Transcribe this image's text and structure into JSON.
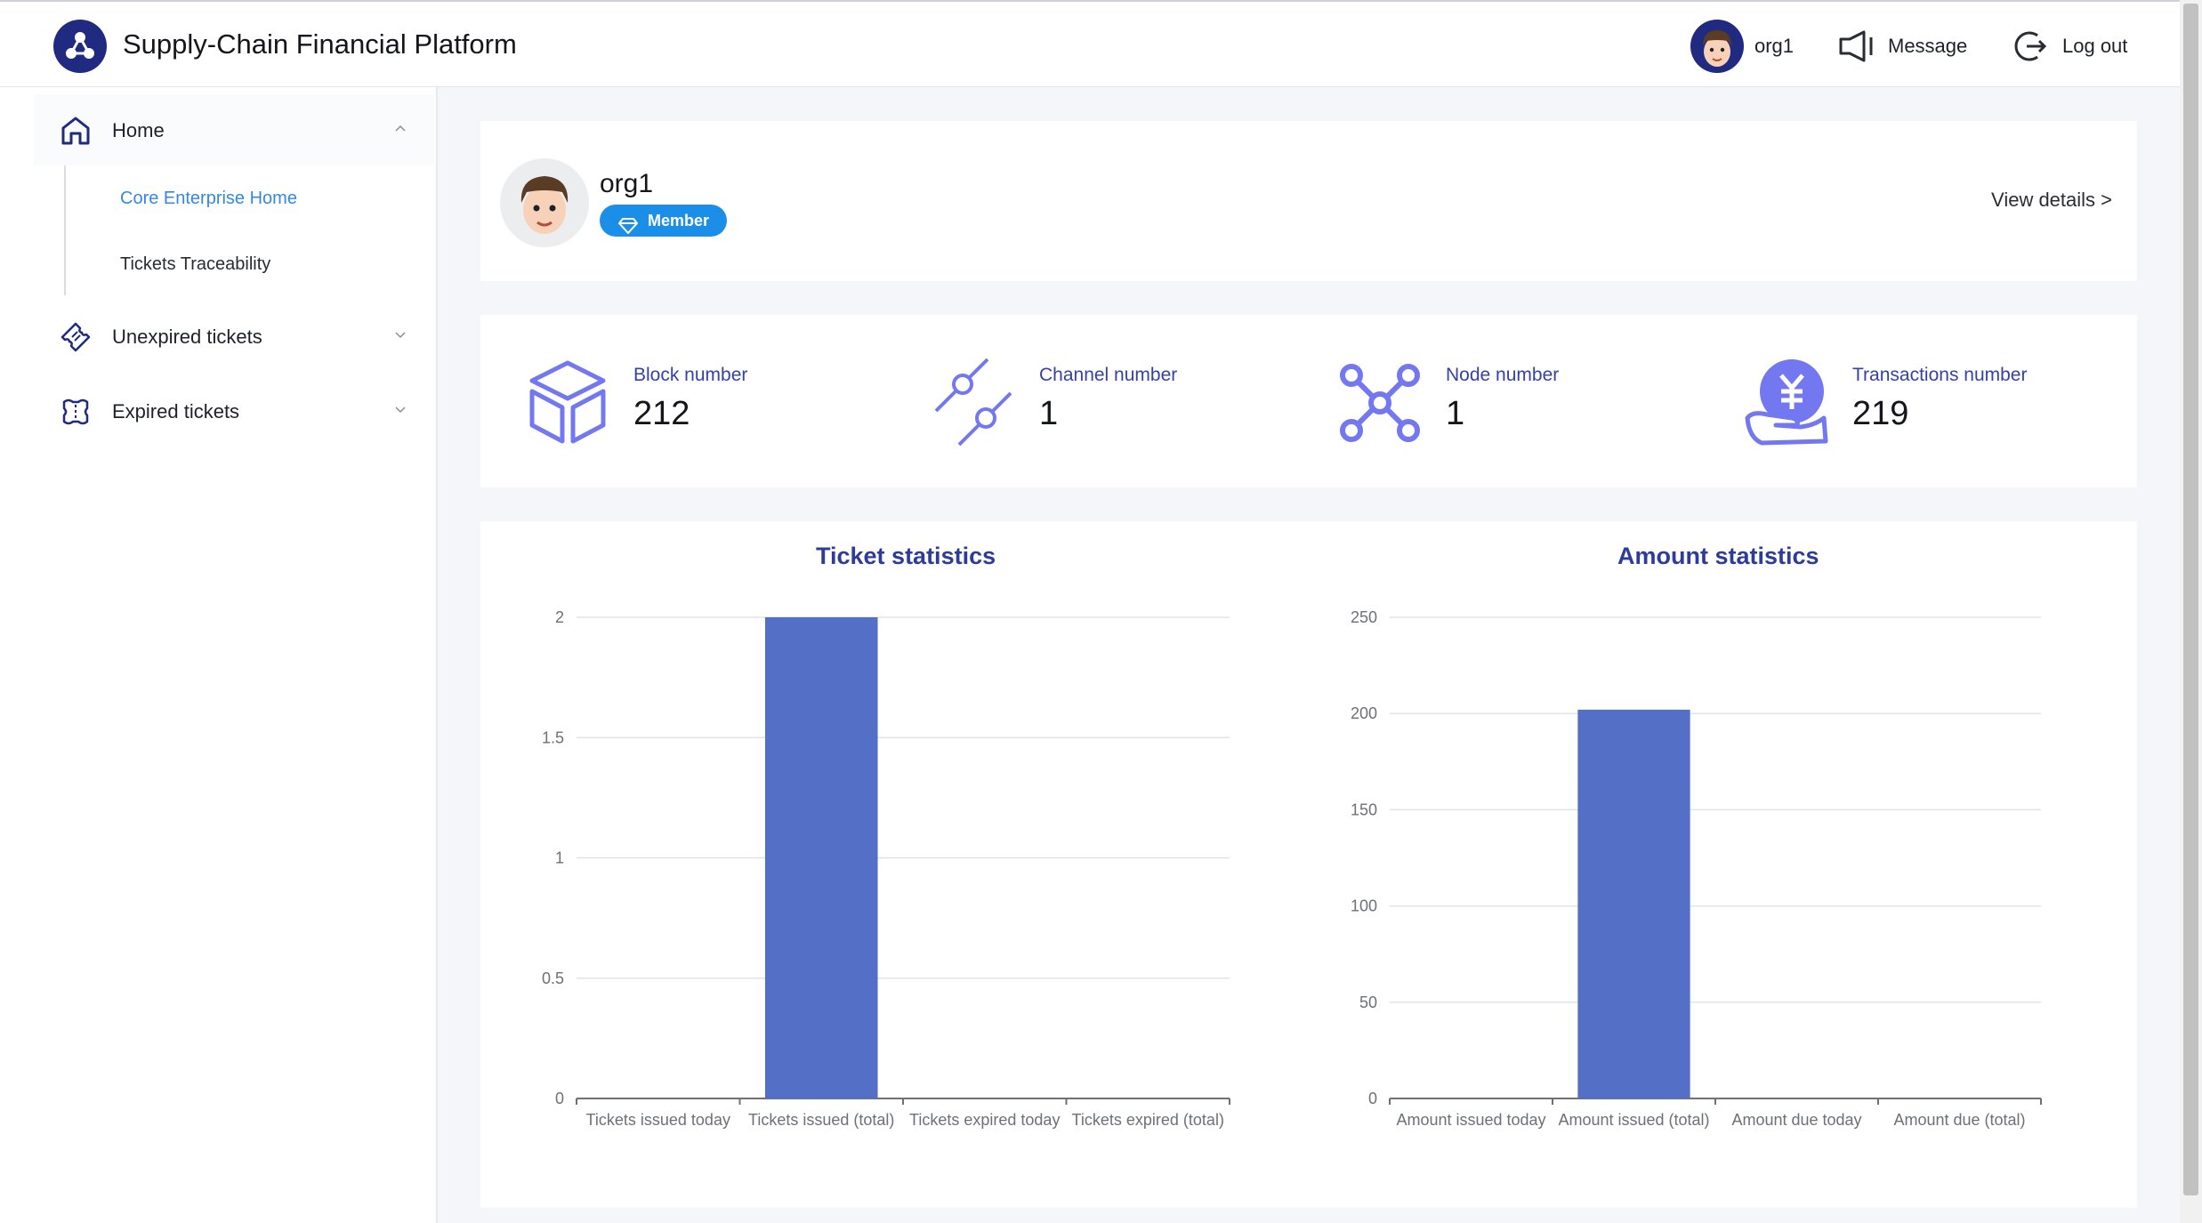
{
  "header": {
    "app_title": "Supply-Chain Financial Platform",
    "user_name": "org1",
    "message_label": "Message",
    "logout_label": "Log out",
    "brand_color": "#1f2a80"
  },
  "sidebar": {
    "items": [
      {
        "label": "Home",
        "icon": "home-icon",
        "expanded": true
      },
      {
        "label": "Unexpired tickets",
        "icon": "ticket-icon",
        "expanded": false
      },
      {
        "label": "Expired tickets",
        "icon": "expired-ticket-icon",
        "expanded": false
      }
    ],
    "sub_items": [
      {
        "label": "Core Enterprise Home",
        "active": true
      },
      {
        "label": "Tickets Traceability",
        "active": false
      }
    ]
  },
  "profile": {
    "name": "org1",
    "badge": "Member",
    "view_details": "View details >"
  },
  "stats": [
    {
      "label": "Block number",
      "value": "212",
      "icon": "cube-icon"
    },
    {
      "label": "Channel number",
      "value": "1",
      "icon": "channel-icon"
    },
    {
      "label": "Node number",
      "value": "1",
      "icon": "node-network-icon"
    },
    {
      "label": "Transactions number",
      "value": "219",
      "icon": "yuan-hand-icon"
    }
  ],
  "colors": {
    "accent": "#3487e9",
    "bar": "#5470c6",
    "stat_icon": "#7378f0",
    "badge": "#1b8fe8"
  },
  "chart_data": [
    {
      "type": "bar",
      "title": "Ticket statistics",
      "categories": [
        "Tickets issued today",
        "Tickets issued (total)",
        "Tickets expired today",
        "Tickets expired (total)"
      ],
      "values": [
        0,
        2,
        0,
        0
      ],
      "ylim": [
        0,
        2
      ],
      "yticks": [
        "0",
        "0.5",
        "1",
        "1.5",
        "2"
      ],
      "grid": true
    },
    {
      "type": "bar",
      "title": "Amount statistics",
      "categories": [
        "Amount issued today",
        "Amount issued (total)",
        "Amount due today",
        "Amount due (total)"
      ],
      "values": [
        0,
        202,
        0,
        0
      ],
      "ylim": [
        0,
        250
      ],
      "yticks": [
        "0",
        "50",
        "100",
        "150",
        "200",
        "250"
      ],
      "grid": true
    }
  ]
}
